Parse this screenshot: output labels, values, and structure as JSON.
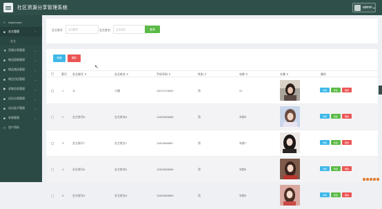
{
  "header": {
    "title": "社区资源分享管理系统",
    "user": "admin"
  },
  "sidebar": {
    "items": [
      {
        "icon": "○",
        "label": "Dashboard"
      },
      {
        "icon": "■",
        "label": "业主管理",
        "active": true
      },
      {
        "icon": "▼",
        "label": "资源分享管理"
      },
      {
        "icon": "■",
        "label": "物品租借管理"
      },
      {
        "icon": "■",
        "label": "物品借还管理"
      },
      {
        "icon": "■",
        "label": "物品归还管理"
      },
      {
        "icon": "▶",
        "label": "求助信息管理"
      },
      {
        "icon": "■",
        "label": "论坛分类管理"
      },
      {
        "icon": "■",
        "label": "论坛帖子管理"
      },
      {
        "icon": "■",
        "label": "系统管理"
      },
      {
        "icon": "□",
        "label": "用户资料"
      }
    ],
    "sub": "业主"
  },
  "search": {
    "label1": "业主账号",
    "placeholder1": "业主账号",
    "label2": "业主姓名",
    "placeholder2": "业主姓名",
    "button": "查询"
  },
  "toolbar": {
    "add": "新增",
    "delete": "删除"
  },
  "table": {
    "headers": [
      "索引",
      "业主账号 ⇕",
      "业主姓名 ⇕",
      "手机号码 ⇕",
      "性别 ⇕",
      "年龄 ⇕",
      "头像 ⇕",
      "操作"
    ],
    "rows": [
      {
        "index": "1",
        "account": "11",
        "name": "小雅",
        "phone": "15074123639",
        "gender": "男",
        "age": "22"
      },
      {
        "index": "2",
        "account": "业主账号8",
        "name": "业主姓名8",
        "phone": "13823888888",
        "gender": "男",
        "age": "年龄8"
      },
      {
        "index": "3",
        "account": "业主账号7",
        "name": "业主姓名7",
        "phone": "13823888887",
        "gender": "男",
        "age": "年龄7"
      },
      {
        "index": "4",
        "account": "业主账号6",
        "name": "业主姓名6",
        "phone": "13823888886",
        "gender": "男",
        "age": "年龄6"
      },
      {
        "index": "5",
        "account": "业主账号5",
        "name": "业主姓名5",
        "phone": "13823888885",
        "gender": "男",
        "age": "年龄5"
      }
    ],
    "ops": {
      "view": "详情",
      "edit": "修改",
      "remove": "删除"
    }
  }
}
